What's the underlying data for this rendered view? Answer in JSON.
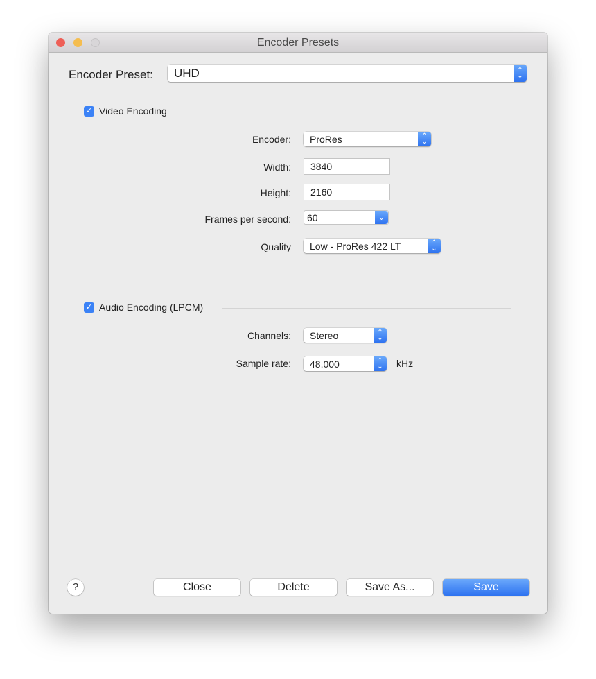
{
  "window": {
    "title": "Encoder Presets"
  },
  "preset": {
    "label": "Encoder Preset:",
    "value": "UHD"
  },
  "video": {
    "label": "Video Encoding",
    "checked": true,
    "encoder_label": "Encoder:",
    "encoder": "ProRes",
    "width_label": "Width:",
    "width": "3840",
    "height_label": "Height:",
    "height": "2160",
    "fps_label": "Frames per second:",
    "fps": "60",
    "quality_label": "Quality",
    "quality": "Low - ProRes 422 LT"
  },
  "audio": {
    "label": "Audio Encoding (LPCM)",
    "checked": true,
    "channels_label": "Channels:",
    "channels": "Stereo",
    "rate_label": "Sample rate:",
    "rate": "48.000",
    "rate_unit": "kHz"
  },
  "buttons": {
    "help": "?",
    "close": "Close",
    "delete": "Delete",
    "save_as": "Save As...",
    "save": "Save"
  }
}
